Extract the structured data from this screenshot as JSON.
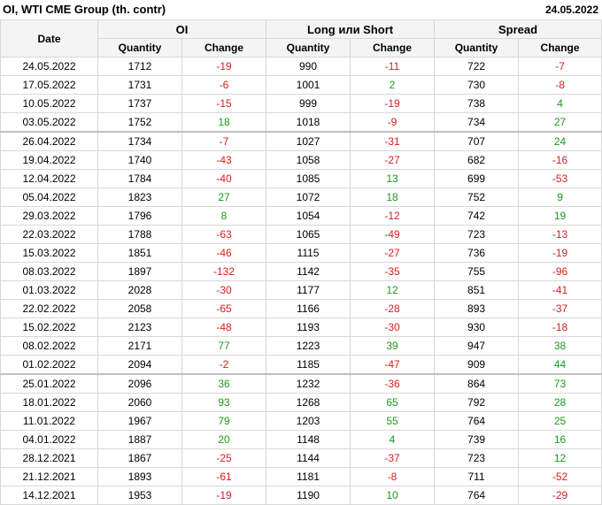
{
  "header": {
    "title": "OI, WTI CME Group (th. contr)",
    "date": "24.05.2022"
  },
  "columns": {
    "date": "Date",
    "groups": [
      "OI",
      "Long или Short",
      "Spread"
    ],
    "quantity": "Quantity",
    "change": "Change"
  },
  "colors": {
    "positive": "#1a9a1a",
    "negative": "#d42020"
  },
  "rows": [
    {
      "date": "24.05.2022",
      "oi_q": "1712",
      "oi_c": "-19",
      "ls_q": "990",
      "ls_c": "-11",
      "sp_q": "722",
      "sp_c": "-7"
    },
    {
      "date": "17.05.2022",
      "oi_q": "1731",
      "oi_c": "-6",
      "ls_q": "1001",
      "ls_c": "2",
      "sp_q": "730",
      "sp_c": "-8"
    },
    {
      "date": "10.05.2022",
      "oi_q": "1737",
      "oi_c": "-15",
      "ls_q": "999",
      "ls_c": "-19",
      "sp_q": "738",
      "sp_c": "4"
    },
    {
      "date": "03.05.2022",
      "oi_q": "1752",
      "oi_c": "18",
      "ls_q": "1018",
      "ls_c": "-9",
      "sp_q": "734",
      "sp_c": "27"
    },
    {
      "date": "26.04.2022",
      "oi_q": "1734",
      "oi_c": "-7",
      "ls_q": "1027",
      "ls_c": "-31",
      "sp_q": "707",
      "sp_c": "24"
    },
    {
      "date": "19.04.2022",
      "oi_q": "1740",
      "oi_c": "-43",
      "ls_q": "1058",
      "ls_c": "-27",
      "sp_q": "682",
      "sp_c": "-16"
    },
    {
      "date": "12.04.2022",
      "oi_q": "1784",
      "oi_c": "-40",
      "ls_q": "1085",
      "ls_c": "13",
      "sp_q": "699",
      "sp_c": "-53"
    },
    {
      "date": "05.04.2022",
      "oi_q": "1823",
      "oi_c": "27",
      "ls_q": "1072",
      "ls_c": "18",
      "sp_q": "752",
      "sp_c": "9"
    },
    {
      "date": "29.03.2022",
      "oi_q": "1796",
      "oi_c": "8",
      "ls_q": "1054",
      "ls_c": "-12",
      "sp_q": "742",
      "sp_c": "19"
    },
    {
      "date": "22.03.2022",
      "oi_q": "1788",
      "oi_c": "-63",
      "ls_q": "1065",
      "ls_c": "-49",
      "sp_q": "723",
      "sp_c": "-13"
    },
    {
      "date": "15.03.2022",
      "oi_q": "1851",
      "oi_c": "-46",
      "ls_q": "1115",
      "ls_c": "-27",
      "sp_q": "736",
      "sp_c": "-19"
    },
    {
      "date": "08.03.2022",
      "oi_q": "1897",
      "oi_c": "-132",
      "ls_q": "1142",
      "ls_c": "-35",
      "sp_q": "755",
      "sp_c": "-96"
    },
    {
      "date": "01.03.2022",
      "oi_q": "2028",
      "oi_c": "-30",
      "ls_q": "1177",
      "ls_c": "12",
      "sp_q": "851",
      "sp_c": "-41"
    },
    {
      "date": "22.02.2022",
      "oi_q": "2058",
      "oi_c": "-65",
      "ls_q": "1166",
      "ls_c": "-28",
      "sp_q": "893",
      "sp_c": "-37"
    },
    {
      "date": "15.02.2022",
      "oi_q": "2123",
      "oi_c": "-48",
      "ls_q": "1193",
      "ls_c": "-30",
      "sp_q": "930",
      "sp_c": "-18"
    },
    {
      "date": "08.02.2022",
      "oi_q": "2171",
      "oi_c": "77",
      "ls_q": "1223",
      "ls_c": "39",
      "sp_q": "947",
      "sp_c": "38"
    },
    {
      "date": "01.02.2022",
      "oi_q": "2094",
      "oi_c": "-2",
      "ls_q": "1185",
      "ls_c": "-47",
      "sp_q": "909",
      "sp_c": "44"
    },
    {
      "date": "25.01.2022",
      "oi_q": "2096",
      "oi_c": "36",
      "ls_q": "1232",
      "ls_c": "-36",
      "sp_q": "864",
      "sp_c": "73"
    },
    {
      "date": "18.01.2022",
      "oi_q": "2060",
      "oi_c": "93",
      "ls_q": "1268",
      "ls_c": "65",
      "sp_q": "792",
      "sp_c": "28"
    },
    {
      "date": "11.01.2022",
      "oi_q": "1967",
      "oi_c": "79",
      "ls_q": "1203",
      "ls_c": "55",
      "sp_q": "764",
      "sp_c": "25"
    },
    {
      "date": "04.01.2022",
      "oi_q": "1887",
      "oi_c": "20",
      "ls_q": "1148",
      "ls_c": "4",
      "sp_q": "739",
      "sp_c": "16"
    },
    {
      "date": "28.12.2021",
      "oi_q": "1867",
      "oi_c": "-25",
      "ls_q": "1144",
      "ls_c": "-37",
      "sp_q": "723",
      "sp_c": "12"
    },
    {
      "date": "21.12.2021",
      "oi_q": "1893",
      "oi_c": "-61",
      "ls_q": "1181",
      "ls_c": "-8",
      "sp_q": "711",
      "sp_c": "-52"
    },
    {
      "date": "14.12.2021",
      "oi_q": "1953",
      "oi_c": "-19",
      "ls_q": "1190",
      "ls_c": "10",
      "sp_q": "764",
      "sp_c": "-29"
    }
  ]
}
